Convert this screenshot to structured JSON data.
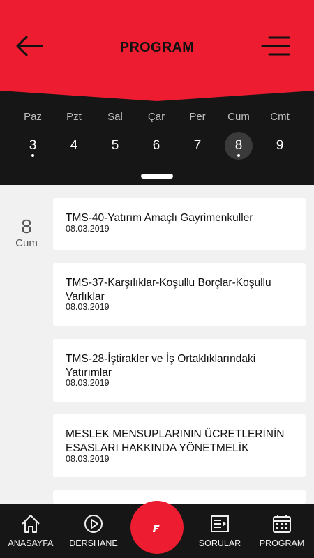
{
  "header": {
    "title": "PROGRAM"
  },
  "week": [
    {
      "name": "Paz",
      "num": "3",
      "dot": true
    },
    {
      "name": "Pzt",
      "num": "4",
      "dot": false
    },
    {
      "name": "Sal",
      "num": "5",
      "dot": false
    },
    {
      "name": "Çar",
      "num": "6",
      "dot": false
    },
    {
      "name": "Per",
      "num": "7",
      "dot": false
    },
    {
      "name": "Cum",
      "num": "8",
      "dot": true,
      "selected": true
    },
    {
      "name": "Cmt",
      "num": "9",
      "dot": false
    }
  ],
  "selected_date": {
    "day": "8",
    "weekday": "Cum"
  },
  "events": [
    {
      "title": "TMS-40-Yatırım Amaçlı Gayrimenkuller",
      "date": "08.03.2019"
    },
    {
      "title": "TMS-37-Karşılıklar-Koşullu Borçlar-Koşullu Varlıklar",
      "date": "08.03.2019"
    },
    {
      "title": "TMS-28-İştirakler ve İş Ortaklıklarındaki Yatırımlar",
      "date": "08.03.2019"
    },
    {
      "title": "MESLEK MENSUPLARININ ÜCRETLERİNİN ESASLARI HAKKINDA YÖNETMELİK",
      "date": "08.03.2019"
    }
  ],
  "nav": {
    "home": "ANASAYFA",
    "dershane": "DERSHANE",
    "sorular": "SORULAR",
    "program": "PROGRAM"
  },
  "colors": {
    "accent": "#ed1c30",
    "dark": "#161616",
    "background": "#f1f1f1"
  }
}
